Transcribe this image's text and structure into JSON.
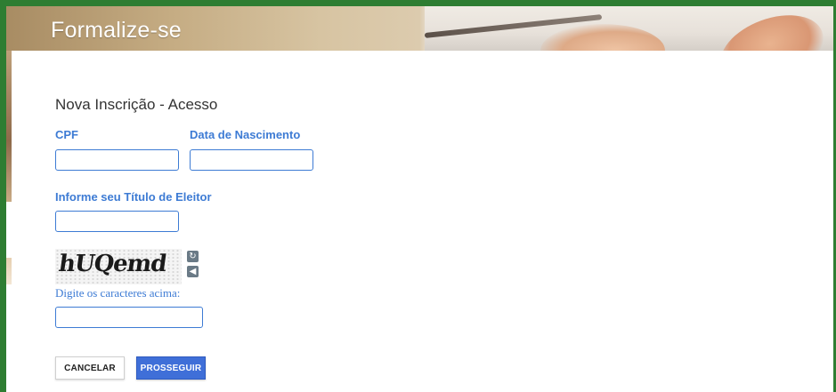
{
  "header": {
    "title": "Formalize-se"
  },
  "form": {
    "section_title": "Nova Inscrição - Acesso",
    "cpf_label": "CPF",
    "cpf_value": "",
    "birth_label": "Data de Nascimento",
    "birth_value": "",
    "voter_label": "Informe seu Título de Eleitor",
    "voter_value": "",
    "captcha_text": "hUQemd",
    "captcha_hint": "Digite os caracteres acima:",
    "captcha_value": ""
  },
  "buttons": {
    "cancel": "CANCELAR",
    "proceed": "PROSSEGUIR"
  },
  "icons": {
    "captcha_refresh": "refresh-icon",
    "captcha_audio": "audio-icon"
  },
  "colors": {
    "accent": "#3d7bd4",
    "frame": "#2e7d32",
    "primary_button": "#3f6fd8"
  }
}
